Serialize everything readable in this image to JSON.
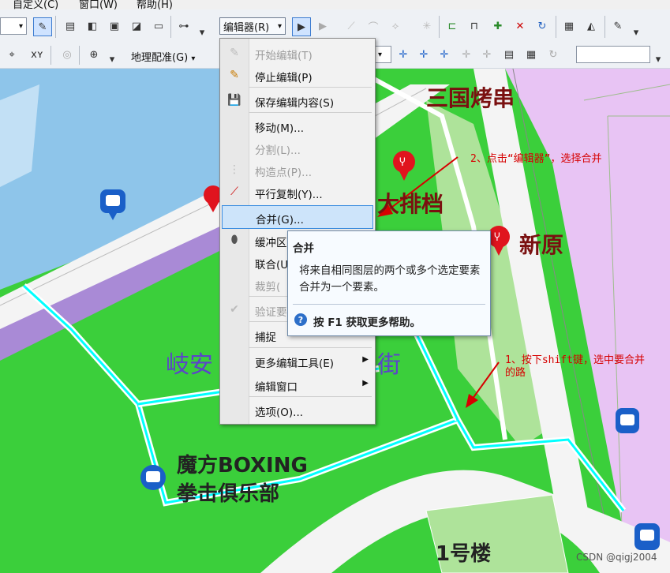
{
  "menubar": {
    "customize": "自定义(C)",
    "window": "窗口(W)",
    "help": "帮助(H)"
  },
  "toolbar": {
    "editor_dropdown_label": "编辑器(R)",
    "georef_dropdown_label": "地理配准(G)",
    "search_value": ""
  },
  "editor_menu": {
    "items": [
      {
        "label": "开始编辑(T)"
      },
      {
        "label": "停止编辑(P)"
      },
      {
        "label": "保存编辑内容(S)"
      },
      {
        "label": "移动(M)..."
      },
      {
        "label": "分割(L)..."
      },
      {
        "label": "构造点(P)..."
      },
      {
        "label": "平行复制(Y)..."
      },
      {
        "label": "合并(G)..."
      },
      {
        "label": "缓冲区"
      },
      {
        "label": "联合(U"
      },
      {
        "label": "裁剪("
      },
      {
        "label": "验证要"
      },
      {
        "label": "捕捉"
      },
      {
        "label": "更多编辑工具(E)"
      },
      {
        "label": "编辑窗口"
      },
      {
        "label": "选项(O)..."
      }
    ]
  },
  "tooltip": {
    "title": "合并",
    "description": "将来自相同图层的两个或多个选定要素合并为一个要素。",
    "help": "按 F1 获取更多帮助。"
  },
  "map": {
    "labels": {
      "sanguo": "三国烤串",
      "dapaidang": "大排档",
      "xinyuan": "新原",
      "qian": "岐安",
      "jie": "街",
      "boxing_1": "魔方BOXING",
      "boxing_2": "拳击俱乐部",
      "building": "1号楼"
    }
  },
  "annotations": {
    "step2": "2、点击“编辑器”，选择合并",
    "step1_line1": "1、按下shift键，选中要合并",
    "step1_line2": "的路"
  },
  "watermark": "CSDN @qigj2004",
  "colors": {
    "map_green": "#3bcf3b",
    "road_white": "#ffffff",
    "selection_cyan": "#00ffff",
    "annotation_red": "#d60000",
    "purple_zone": "#e6c6f2",
    "menu_highlight": "#cde4fa"
  }
}
